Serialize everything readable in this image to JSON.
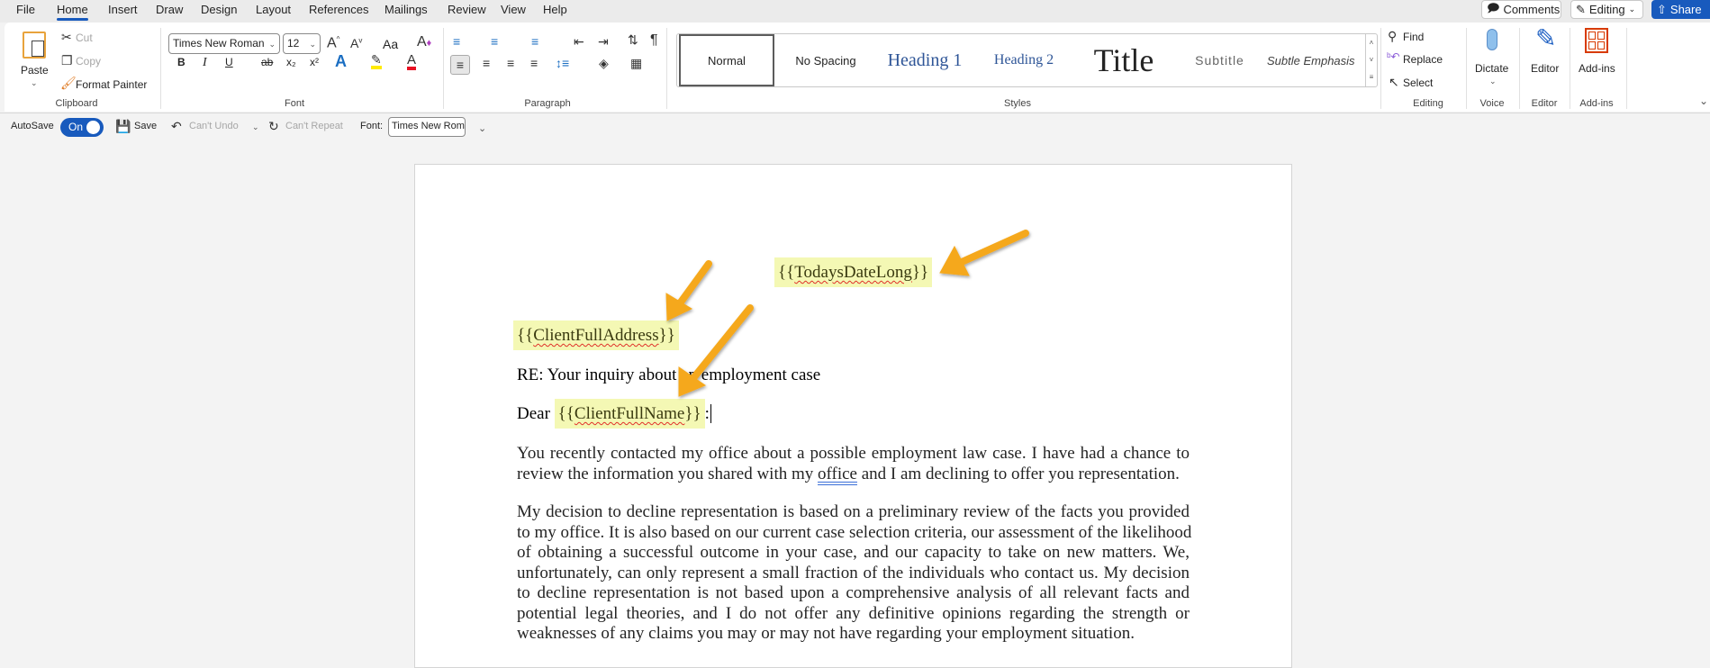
{
  "menu": [
    "File",
    "Home",
    "Insert",
    "Draw",
    "Design",
    "Layout",
    "References",
    "Mailings",
    "Review",
    "View",
    "Help"
  ],
  "top_buttons": {
    "comments": "Comments",
    "editing": "Editing",
    "share": "Share"
  },
  "clipboard": {
    "paste": "Paste",
    "cut": "Cut",
    "copy": "Copy",
    "format_painter": "Format Painter",
    "label": "Clipboard"
  },
  "font": {
    "name": "Times New Roman",
    "size": "12",
    "case": "Aa",
    "label": "Font",
    "bold": "B",
    "italic": "I",
    "underline": "U",
    "strike": "ab",
    "sub": "x₂",
    "sup": "x²"
  },
  "paragraph": {
    "label": "Paragraph"
  },
  "styles": {
    "items": [
      "Normal",
      "No Spacing",
      "Heading 1",
      "Heading 2",
      "Title",
      "Subtitle",
      "Subtle Emphasis"
    ],
    "label": "Styles"
  },
  "editing": {
    "find": "Find",
    "replace": "Replace",
    "select": "Select",
    "label": "Editing"
  },
  "voice": {
    "dictate": "Dictate",
    "label": "Voice"
  },
  "editor": {
    "button": "Editor",
    "label": "Editor"
  },
  "addins": {
    "button": "Add-ins",
    "label": "Add-ins"
  },
  "qat": {
    "autosave": "AutoSave",
    "toggle": "On",
    "save": "Save",
    "undo": "Can't Undo",
    "repeat": "Can't Repeat",
    "font_label": "Font:",
    "font_value": "Times New Roman"
  },
  "colors": {
    "accent": "#185abd",
    "highlight": "#f4f8b4",
    "arrow": "#f5a81c"
  },
  "document": {
    "date_open": "{{",
    "date_field": "TodaysDateLong",
    "date_close": "}}",
    "addr_open": "{{",
    "addr_field": "ClientFullAddress",
    "addr_close": "}}",
    "re_line": "RE: Your inquiry about an employment case",
    "dear": "Dear ",
    "name_open": "{{",
    "name_field": "ClientFullName",
    "name_close": "}}",
    "colon": ":",
    "p1": [
      "You recently contacted my office about a possible employment law case. I have had a chance to"
    ],
    "p1_last_a": "review the information you shared with my ",
    "p1_last_b": "office",
    "p1_last_c": " and I am declining to offer you representation.",
    "p2": [
      "My decision to decline representation is based on a preliminary review of the facts you provided",
      "to my office.  It is also based on our current case selection criteria, our assessment of the likelihood",
      "of obtaining a successful outcome in your case, and our capacity to take on new matters.  We,",
      "unfortunately, can only represent a small fraction of the individuals who contact us.  My decision",
      "to decline representation is not based upon a comprehensive analysis of all relevant facts and",
      "potential legal theories, and I do not offer any definitive opinions regarding the strength or",
      "weaknesses of any claims you may or may not have regarding your employment situation."
    ]
  }
}
